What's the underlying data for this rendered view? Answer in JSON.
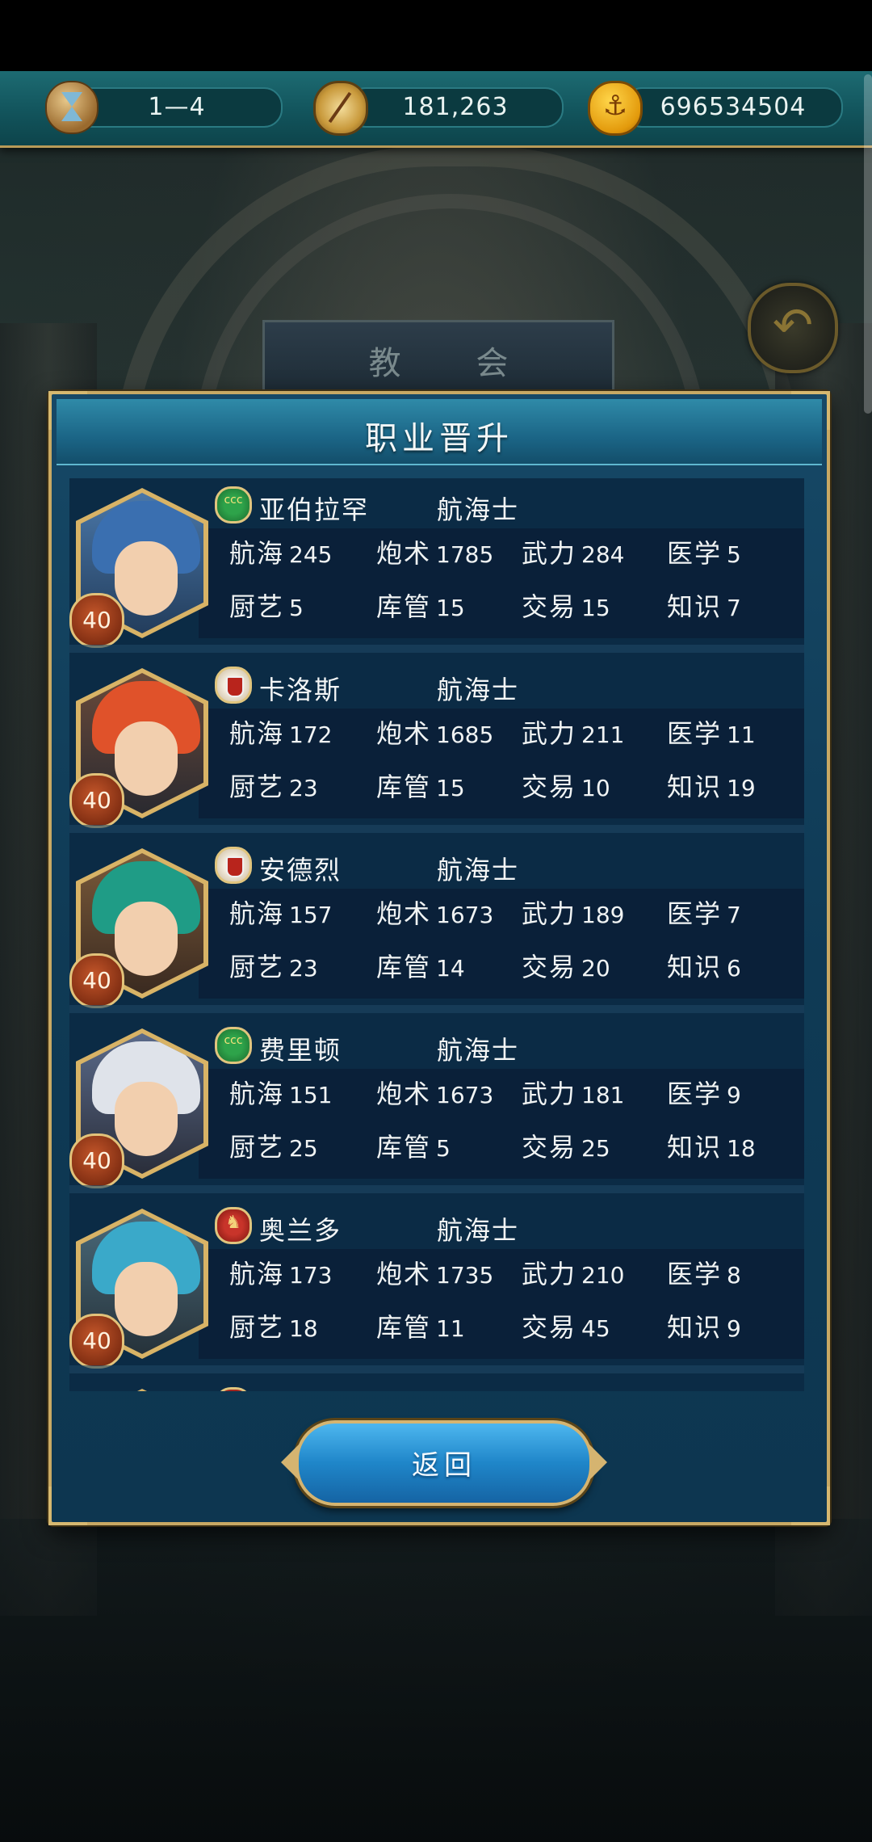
{
  "topbar": {
    "time_value": "1—4",
    "compass_value": "181,263",
    "gold_value": "696534504"
  },
  "background": {
    "building_label": "教 会"
  },
  "panel": {
    "title": "职业晋升",
    "return_button": "返回"
  },
  "stat_labels": {
    "navigation": "航海",
    "gunnery": "炮术",
    "force": "武力",
    "medicine": "医学",
    "cooking": "厨艺",
    "storage": "库管",
    "trade": "交易",
    "knowledge": "知识"
  },
  "sailors": [
    {
      "name": "亚伯拉罕",
      "job": "航海士",
      "level": "40",
      "flag": "green-flag-icon",
      "hair_color": "#3a6fb0",
      "stats": {
        "navigation": "245",
        "gunnery": "1785",
        "force": "284",
        "medicine": "5",
        "cooking": "5",
        "storage": "15",
        "trade": "15",
        "knowledge": "7"
      }
    },
    {
      "name": "卡洛斯",
      "job": "航海士",
      "level": "40",
      "flag": "portugal-flag-icon",
      "hair_color": "#e0522a",
      "stats": {
        "navigation": "172",
        "gunnery": "1685",
        "force": "211",
        "medicine": "11",
        "cooking": "23",
        "storage": "15",
        "trade": "10",
        "knowledge": "19"
      }
    },
    {
      "name": "安德烈",
      "job": "航海士",
      "level": "40",
      "flag": "portugal-flag-icon",
      "hair_color": "#1f9c86",
      "stats": {
        "navigation": "157",
        "gunnery": "1673",
        "force": "189",
        "medicine": "7",
        "cooking": "23",
        "storage": "14",
        "trade": "20",
        "knowledge": "6"
      }
    },
    {
      "name": "费里顿",
      "job": "航海士",
      "level": "40",
      "flag": "green-flag-icon",
      "hair_color": "#dfe3ea",
      "stats": {
        "navigation": "151",
        "gunnery": "1673",
        "force": "181",
        "medicine": "9",
        "cooking": "25",
        "storage": "5",
        "trade": "25",
        "knowledge": "18"
      }
    },
    {
      "name": "奥兰多",
      "job": "航海士",
      "level": "40",
      "flag": "red-flag-icon",
      "hair_color": "#3aa9c9",
      "stats": {
        "navigation": "173",
        "gunnery": "1735",
        "force": "210",
        "medicine": "8",
        "cooking": "18",
        "storage": "11",
        "trade": "45",
        "knowledge": "9"
      }
    }
  ]
}
